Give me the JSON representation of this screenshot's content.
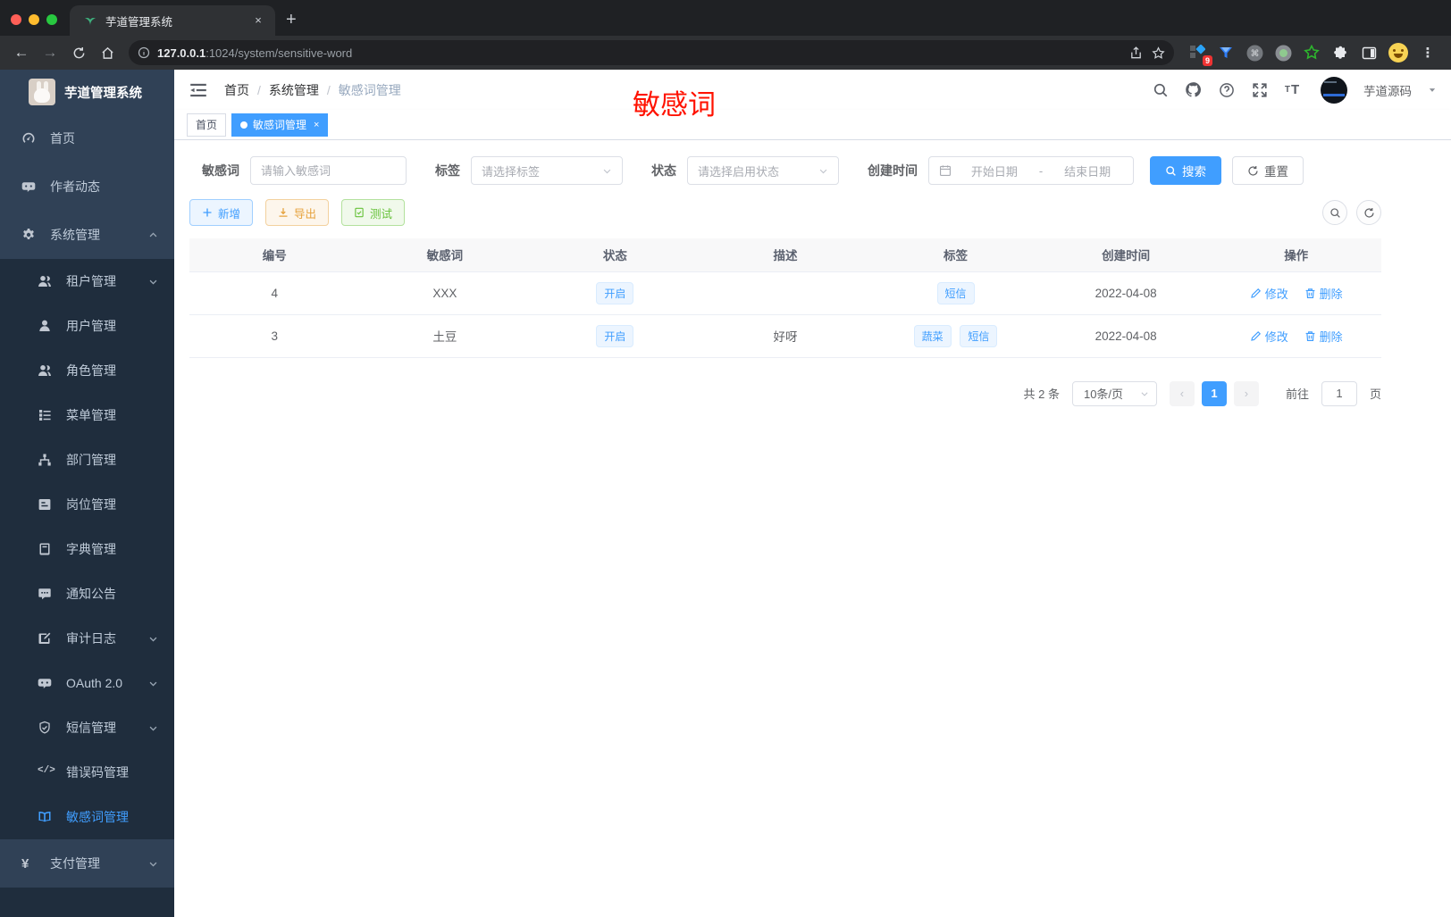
{
  "colors": {
    "accent": "#409eff",
    "annotation_red": "#ff1200",
    "warning": "#e6a23c",
    "success": "#67c23a"
  },
  "browser": {
    "tab_title": "芋道管理系统",
    "url_host": "127.0.0.1",
    "url_rest": ":1024/system/sensitive-word",
    "ext_badge": "9",
    "new_tab_label": "+",
    "close_label": "×"
  },
  "sidebar": {
    "title": "芋道管理系统",
    "items": [
      {
        "label": "首页"
      },
      {
        "label": "作者动态"
      },
      {
        "label": "系统管理"
      },
      {
        "label": "租户管理"
      },
      {
        "label": "用户管理"
      },
      {
        "label": "角色管理"
      },
      {
        "label": "菜单管理"
      },
      {
        "label": "部门管理"
      },
      {
        "label": "岗位管理"
      },
      {
        "label": "字典管理"
      },
      {
        "label": "通知公告"
      },
      {
        "label": "审计日志"
      },
      {
        "label": "OAuth 2.0"
      },
      {
        "label": "短信管理"
      },
      {
        "label": "错误码管理"
      },
      {
        "label": "敏感词管理"
      },
      {
        "label": "支付管理"
      }
    ]
  },
  "breadcrumb": {
    "home": "首页",
    "section": "系统管理",
    "current": "敏感词管理",
    "separator": "/"
  },
  "app_header": {
    "username": "芋道源码"
  },
  "tags_view": {
    "home": "首页",
    "active": "敏感词管理",
    "close": "×"
  },
  "annotation": "敏感词",
  "filters": {
    "keyword_label": "敏感词",
    "keyword_placeholder": "请输入敏感词",
    "tag_label": "标签",
    "tag_placeholder": "请选择标签",
    "status_label": "状态",
    "status_placeholder": "请选择启用状态",
    "date_label": "创建时间",
    "date_start": "开始日期",
    "date_separator": "-",
    "date_end": "结束日期",
    "search": "搜索",
    "reset": "重置"
  },
  "toolbar": {
    "add": "新增",
    "export": "导出",
    "test": "测试"
  },
  "table": {
    "headers": [
      "编号",
      "敏感词",
      "状态",
      "描述",
      "标签",
      "创建时间",
      "操作"
    ],
    "edit": "修改",
    "delete": "删除",
    "rows": [
      {
        "id": "4",
        "word": "XXX",
        "status": "开启",
        "desc": "",
        "tags": [
          "短信"
        ],
        "created": "2022-04-08"
      },
      {
        "id": "3",
        "word": "土豆",
        "status": "开启",
        "desc": "好呀",
        "tags": [
          "蔬菜",
          "短信"
        ],
        "created": "2022-04-08"
      }
    ]
  },
  "pagination": {
    "total": "共 2 条",
    "size": "10条/页",
    "prev": "‹",
    "next": "›",
    "page": "1",
    "goto": "前往",
    "goto_value": "1",
    "unit": "页"
  }
}
